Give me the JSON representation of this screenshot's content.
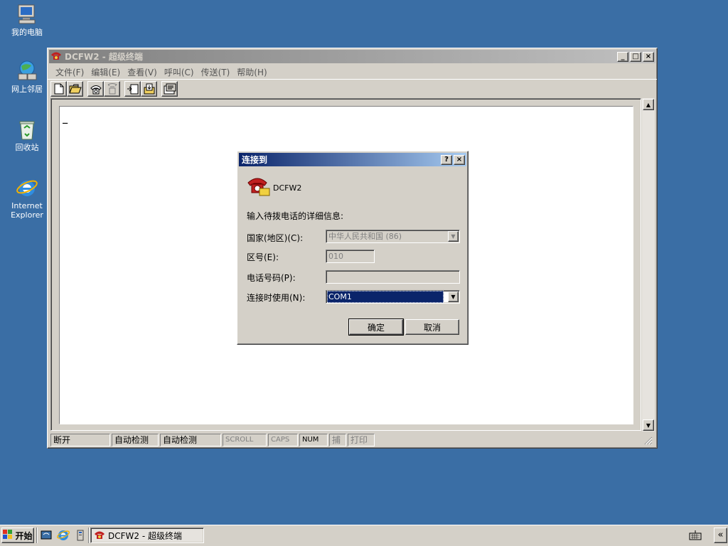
{
  "desktop": {
    "icons": [
      {
        "label": "我的电脑"
      },
      {
        "label": "网上邻居"
      },
      {
        "label": "回收站"
      },
      {
        "label": "Internet Explorer"
      }
    ]
  },
  "window": {
    "title": "DCFW2 - 超级终端",
    "menus": [
      "文件(F)",
      "编辑(E)",
      "查看(V)",
      "呼叫(C)",
      "传送(T)",
      "帮助(H)"
    ],
    "toolbar_icons": [
      "new-icon",
      "open-icon",
      "connect-icon",
      "disconnect-icon",
      "send-icon",
      "receive-icon",
      "properties-icon"
    ],
    "cursor": "_",
    "status": {
      "state": "断开",
      "detect1": "自动检测",
      "detect2": "自动检测",
      "scroll": "SCROLL",
      "caps": "CAPS",
      "num": "NUM",
      "capture": "捕",
      "print": "打印"
    }
  },
  "dialog": {
    "title": "连接到",
    "help_btn": "?",
    "close_btn": "×",
    "connection_name": "DCFW2",
    "prompt": "输入待拨电话的详细信息:",
    "country_label": "国家(地区)(C):",
    "country_value": "中华人民共和国 (86)",
    "area_label": "区号(E):",
    "area_value": "010",
    "phone_label": "电话号码(P):",
    "phone_value": "",
    "connect_using_label": "连接时使用(N):",
    "connect_using_value": "COM1",
    "ok_label": "确定",
    "cancel_label": "取消"
  },
  "taskbar": {
    "start_label": "开始",
    "task_title": "DCFW2 - 超级终端",
    "tray_expand": "«"
  },
  "colors": {
    "desktop": "#3a6ea5",
    "active_title_start": "#0a246a",
    "active_title_end": "#a6caf0",
    "face": "#d4d0c8",
    "selection": "#0a246a"
  }
}
